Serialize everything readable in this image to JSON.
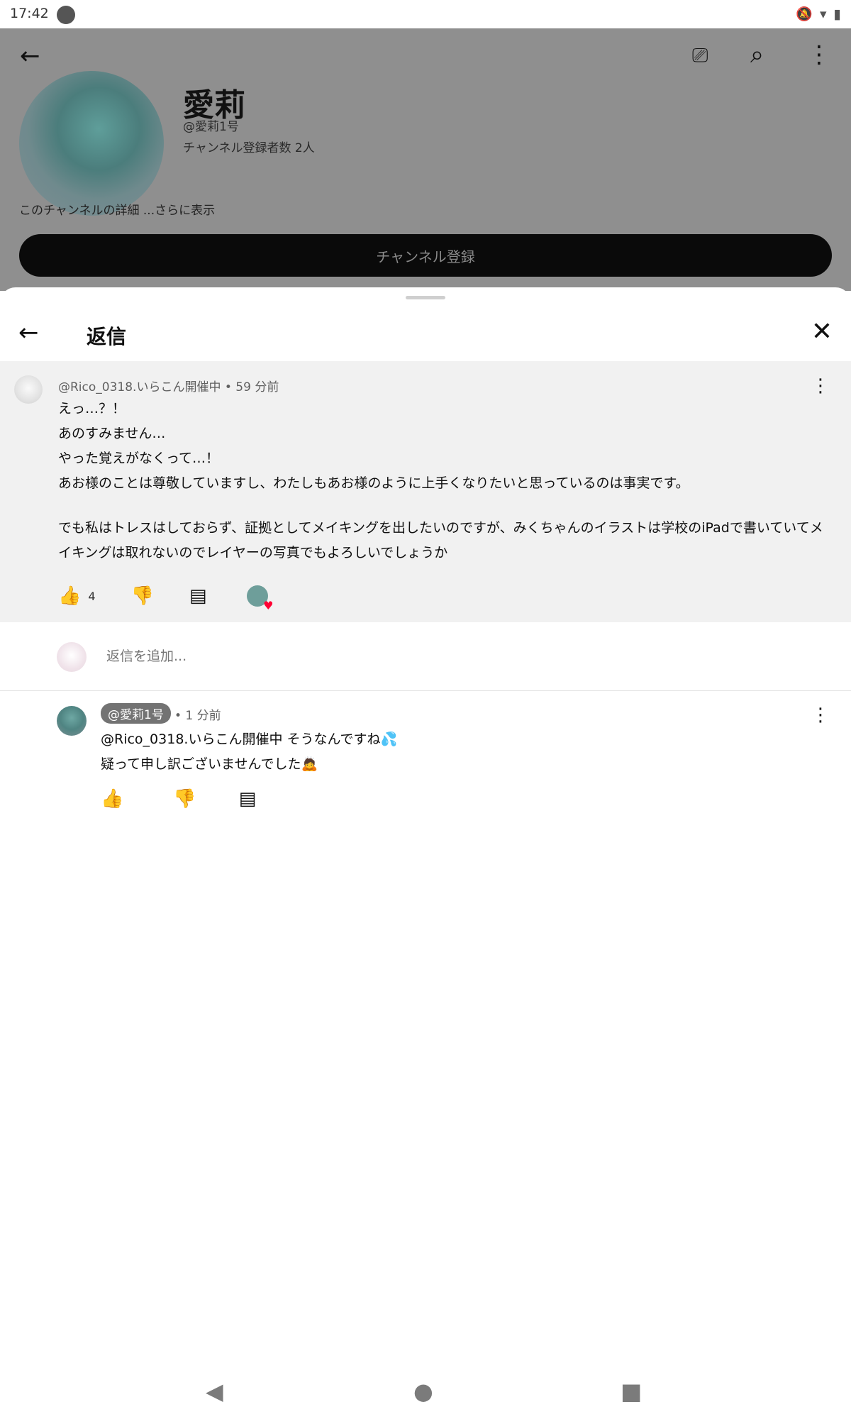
{
  "status_bar": {
    "time": "17:42"
  },
  "channel": {
    "name": "愛莉",
    "handle": "@愛莉1号",
    "subscribers": "チャンネル登録者数 2人",
    "description_more": "このチャンネルの詳細 ...さらに表示",
    "subscribe_label": "チャンネル登録"
  },
  "sheet": {
    "title": "返信",
    "parent": {
      "meta": "@Rico_0318.いらこん開催中 • 59 分前",
      "lines": [
        "えっ…？！",
        "あのすみません…",
        "やった覚えがなくって…！",
        "あお様のことは尊敬していますし、わたしもあお様のように上手くなりたいと思っているのは事実です。",
        "でも私はトレスはしておらず、証拠としてメイキングを出したいのですが、みくちゃんのイラストは学校のiPadで書いていてメイキングは取れないのでレイヤーの写真でもよろしいでしょうか"
      ],
      "like_count": "4"
    },
    "add_reply_placeholder": "返信を追加...",
    "reply": {
      "handle": "@愛莉1号",
      "time": "• 1 分前",
      "line1": "@Rico_0318.いらこん開催中 そうなんですね💦",
      "line2": "疑って申し訳ございませんでした🙇"
    }
  },
  "icons": {
    "back": "arrow-left-icon",
    "cast": "cast-icon",
    "search": "search-icon",
    "more": "more-vert-icon",
    "close": "close-icon",
    "like": "thumb-up-icon",
    "dislike": "thumb-down-icon",
    "reply": "comment-icon"
  }
}
